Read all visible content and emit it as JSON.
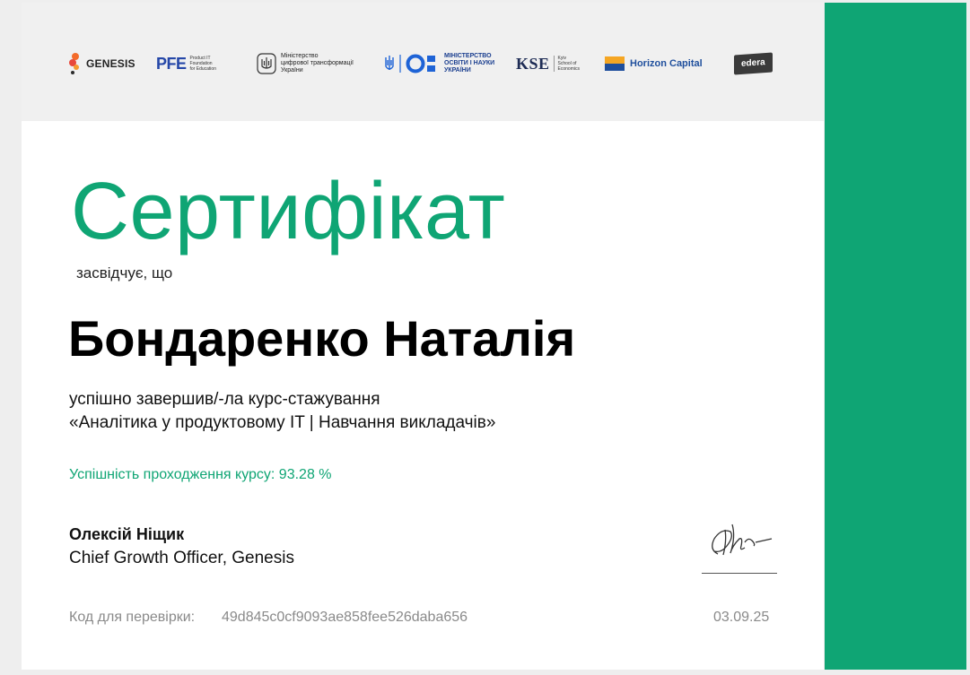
{
  "logos": {
    "genesis": "GENESIS",
    "pfe": {
      "mark": "PFE",
      "caption": [
        "Product IT",
        "Foundation",
        "for Education"
      ]
    },
    "mincifra": {
      "caption": [
        "Міністерство",
        "цифрової трансформації",
        "України"
      ]
    },
    "mon": {
      "caption": [
        "МІНІСТЕРСТВО",
        "ОСВІТИ І НАУКИ",
        "УКРАЇНИ"
      ]
    },
    "kse": {
      "mark": "KSE",
      "caption": [
        "Kyiv",
        "School of",
        "Economics"
      ]
    },
    "horizon": "Horizon Capital",
    "edera": "edera"
  },
  "certificate": {
    "title": "Сертифікат",
    "subtitle": "засвідчує, що",
    "recipient": "Бондаренко Наталія",
    "completed_line": "успішно завершив/-ла курс-стажування",
    "course_line": "«Аналітика у продуктовому IT | Навчання викладачів»",
    "score_line": "Успішність проходження курсу: 93.28 %",
    "signer_name": "Олексій Ніщик",
    "signer_role": "Chief Growth Officer, Genesis",
    "verify_label": "Код для перевірки:",
    "verify_code": "49d845c0cf9093ae858fee526daba656",
    "date": "03.09.25"
  },
  "colors": {
    "accent": "#0fa574",
    "logo_strip": "#f0f0f0"
  }
}
